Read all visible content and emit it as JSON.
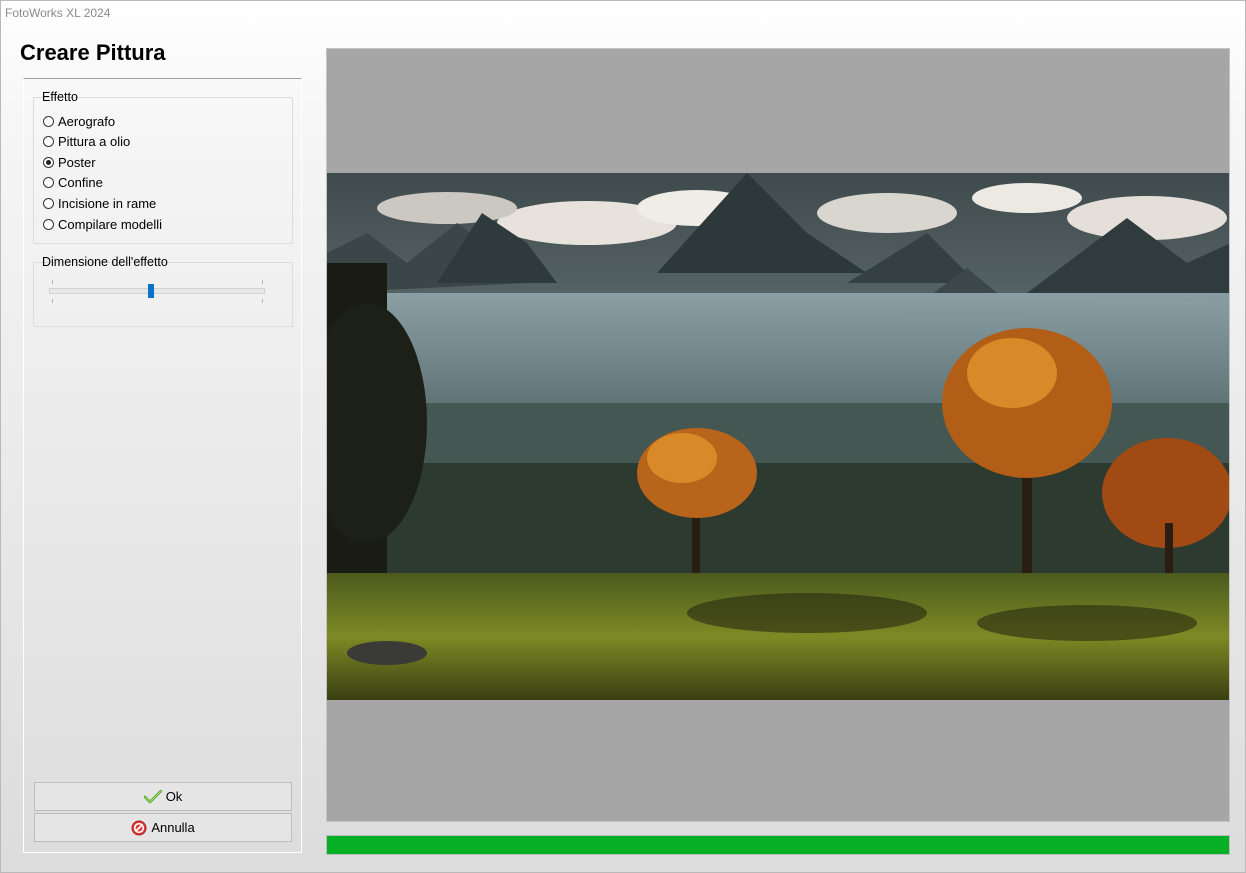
{
  "window": {
    "title": "FotoWorks XL 2024"
  },
  "page_title": "Creare Pittura",
  "effect_group": {
    "legend": "Effetto",
    "options": [
      {
        "label": "Aerografo",
        "checked": false
      },
      {
        "label": "Pittura a olio",
        "checked": false
      },
      {
        "label": "Poster",
        "checked": true
      },
      {
        "label": "Confine",
        "checked": false
      },
      {
        "label": "Incisione in rame",
        "checked": false
      },
      {
        "label": "Compilare modelli",
        "checked": false
      }
    ]
  },
  "size_group": {
    "legend": "Dimensione dell'effetto",
    "slider_value": 0.47
  },
  "buttons": {
    "ok": "Ok",
    "cancel": "Annulla"
  },
  "progress": {
    "value": 1.0
  },
  "colors": {
    "progress": "#06b025",
    "slider_thumb": "#0a72c8",
    "preview_bg": "#a6a6a6"
  }
}
